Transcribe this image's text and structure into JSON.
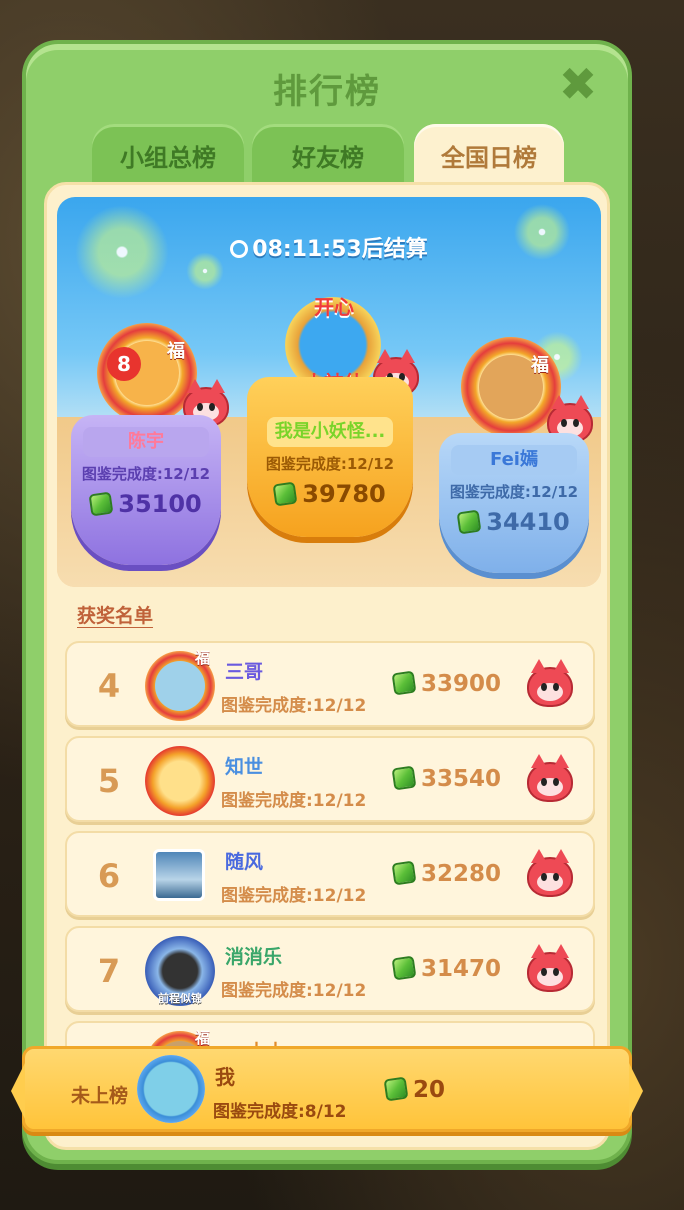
{
  "title": "排行榜",
  "tabs": [
    {
      "label": "小组总榜",
      "active": false
    },
    {
      "label": "好友榜",
      "active": false
    },
    {
      "label": "全国日榜",
      "active": true
    }
  ],
  "timer": {
    "time": "08:11:53",
    "suffix": "后结算"
  },
  "badge": {
    "top_text": "开心",
    "bottom_text": "小神仙"
  },
  "podium": [
    {
      "place": 2,
      "level": "8",
      "fu": "福",
      "name": "陈宇",
      "completion": "图鉴完成度:12/12",
      "score": "35100"
    },
    {
      "place": 1,
      "name": "我是小妖怪...",
      "completion": "图鉴完成度:12/12",
      "score": "39780"
    },
    {
      "place": 3,
      "fu": "福",
      "name": "Fei嫣",
      "completion": "图鉴完成度:12/12",
      "score": "34410"
    }
  ],
  "section_title": "获奖名单",
  "rows": [
    {
      "rank": "4",
      "name": "三哥",
      "name_color": "#6a5adf",
      "completion": "图鉴完成度:12/12",
      "score": "33900",
      "fu": "福"
    },
    {
      "rank": "5",
      "name": "知世",
      "name_color": "#4a8fe0",
      "completion": "图鉴完成度:12/12",
      "score": "33540"
    },
    {
      "rank": "6",
      "name": "随风",
      "name_color": "#4a6adf",
      "completion": "图鉴完成度:12/12",
      "score": "32280"
    },
    {
      "rank": "7",
      "name": "消消乐",
      "name_color": "#3aa66a",
      "completion": "图鉴完成度:12/12",
      "score": "31470",
      "avatar_caption": "前程似锦"
    }
  ],
  "next_row_partial": {
    "name": "木木",
    "fu": "福"
  },
  "me": {
    "status": "未上榜",
    "name": "我",
    "completion": "图鉴完成度:8/12",
    "score": "20"
  },
  "colors": {
    "panel_green": "#8fcf6a",
    "tab_active_bg": "#fdf1cf",
    "podium_purple": "#8e72e0",
    "podium_gold": "#f6a21e",
    "podium_blue": "#7fb0ea",
    "score_brown": "#d48c4a"
  },
  "icons": [
    "close-icon",
    "clock-icon",
    "gem-icon",
    "fox-icon",
    "fu-avatar-frame"
  ]
}
